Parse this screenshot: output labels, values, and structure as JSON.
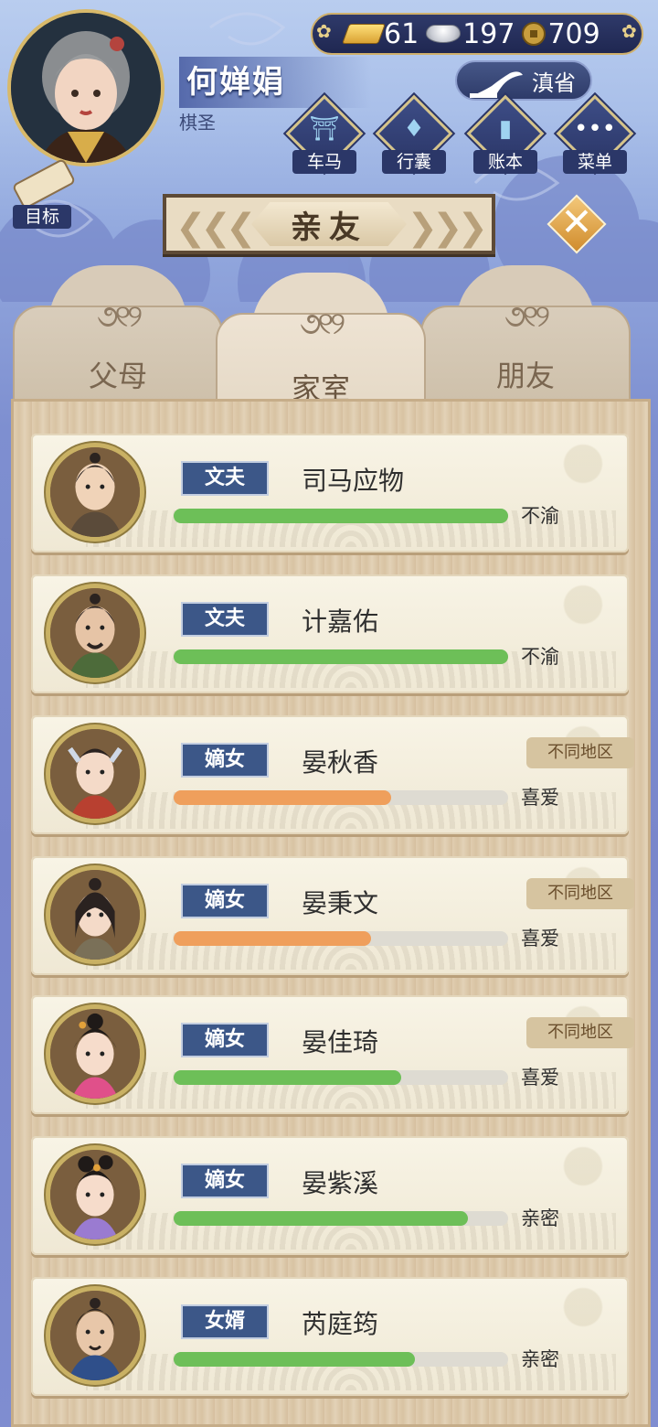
{
  "player": {
    "name": "何婵娟",
    "title": "棋圣"
  },
  "currency": {
    "gold": "61",
    "silver": "197",
    "coins": "709"
  },
  "region": "滇省",
  "menu": [
    {
      "label": "车马",
      "icon": "carriage-icon"
    },
    {
      "label": "行囊",
      "icon": "bag-icon"
    },
    {
      "label": "账本",
      "icon": "ledger-icon"
    },
    {
      "label": "菜单",
      "icon": "more-icon"
    }
  ],
  "goal_label": "目标",
  "title": "亲友",
  "tabs": [
    {
      "label": "父母"
    },
    {
      "label": "家室"
    },
    {
      "label": "朋友"
    }
  ],
  "active_tab": 1,
  "relatives": [
    {
      "role": "文夫",
      "name": "司马应物",
      "status": "不渝",
      "progress": 1.0,
      "bar_color": "#6dbf58",
      "region": ""
    },
    {
      "role": "文夫",
      "name": "计嘉佑",
      "status": "不渝",
      "progress": 1.0,
      "bar_color": "#6dbf58",
      "region": ""
    },
    {
      "role": "嫡女",
      "name": "晏秋香",
      "status": "喜爱",
      "progress": 0.65,
      "bar_color": "#ef9f5c",
      "region": "不同地区"
    },
    {
      "role": "嫡女",
      "name": "晏秉文",
      "status": "喜爱",
      "progress": 0.59,
      "bar_color": "#ef9f5c",
      "region": "不同地区"
    },
    {
      "role": "嫡女",
      "name": "晏佳琦",
      "status": "喜爱",
      "progress": 0.68,
      "bar_color": "#6dbf58",
      "region": "不同地区"
    },
    {
      "role": "嫡女",
      "name": "晏紫溪",
      "status": "亲密",
      "progress": 0.88,
      "bar_color": "#6dbf58",
      "region": ""
    },
    {
      "role": "女婿",
      "name": "芮庭筠",
      "status": "亲密",
      "progress": 0.72,
      "bar_color": "#6dbf58",
      "region": ""
    }
  ]
}
